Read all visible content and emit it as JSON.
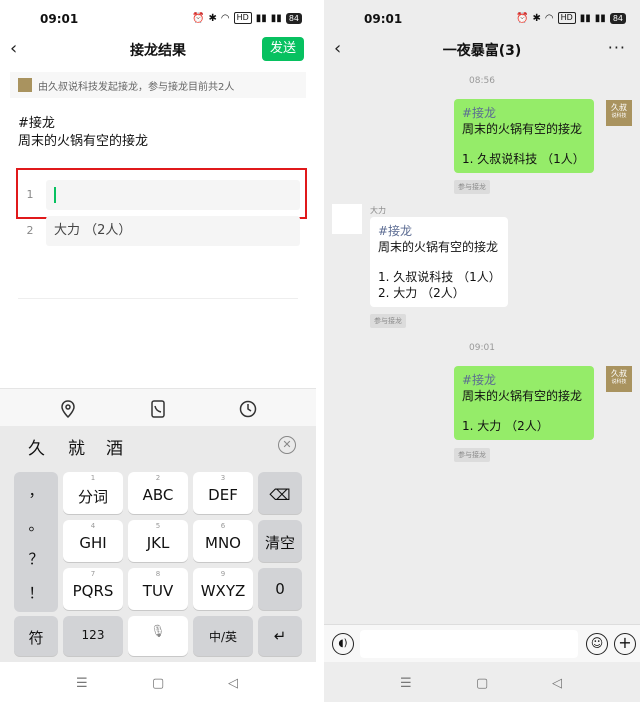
{
  "left_phone": {
    "status_time": "09:01",
    "status_icons": [
      "alarm-icon",
      "bluetooth-icon",
      "wifi-icon",
      "hd-icon",
      "signal-icon",
      "signal-icon"
    ],
    "battery": "84",
    "hd_label": "HD",
    "nav_title": "接龙结果",
    "send_label": "发送",
    "info_text": "由久叔说科技发起接龙，参与接龙目前共2人",
    "hashtag": "#接龙",
    "description": "周末的火锅有空的接龙",
    "entries": [
      {
        "num": "1",
        "value": ""
      },
      {
        "num": "2",
        "value": "大力 （2人）"
      }
    ],
    "keyboard": {
      "candidates": [
        "久",
        "就",
        "酒"
      ],
      "punct": [
        "，",
        "。",
        "？",
        "！"
      ],
      "rows": [
        [
          {
            "sub": "1",
            "main": "分词"
          },
          {
            "sub": "2",
            "main": "ABC"
          },
          {
            "sub": "3",
            "main": "DEF"
          }
        ],
        [
          {
            "sub": "4",
            "main": "GHI"
          },
          {
            "sub": "5",
            "main": "JKL"
          },
          {
            "sub": "6",
            "main": "MNO"
          }
        ],
        [
          {
            "sub": "7",
            "main": "PQRS"
          },
          {
            "sub": "8",
            "main": "TUV"
          },
          {
            "sub": "9",
            "main": "WXYZ"
          }
        ]
      ],
      "clear_label": "清空",
      "zero_label": "0",
      "symbol_label": "符",
      "num_label": "123",
      "lang_label": "中/英"
    }
  },
  "right_phone": {
    "status_time": "09:01",
    "battery": "84",
    "hd_label": "HD",
    "nav_title": "一夜暴富(3)",
    "brand_avatar_text": "久叔",
    "brand_avatar_sub": "说科技",
    "messages": [
      {
        "time": "08:56"
      },
      {
        "hashtag": "#接龙",
        "desc": "周末的火锅有空的接龙",
        "lines": [
          "1. 久叔说科技 （1人）"
        ],
        "chip": "参与接龙"
      },
      {
        "sender": "大力",
        "hashtag": "#接龙",
        "desc": "周末的火锅有空的接龙",
        "lines": [
          "1. 久叔说科技 （1人）",
          "2. 大力 （2人）"
        ],
        "chip": "参与接龙"
      },
      {
        "time": "09:01"
      },
      {
        "hashtag": "#接龙",
        "desc": "周末的火锅有空的接龙",
        "lines": [
          "1. 大力 （2人）"
        ],
        "chip": "参与接龙"
      }
    ]
  }
}
